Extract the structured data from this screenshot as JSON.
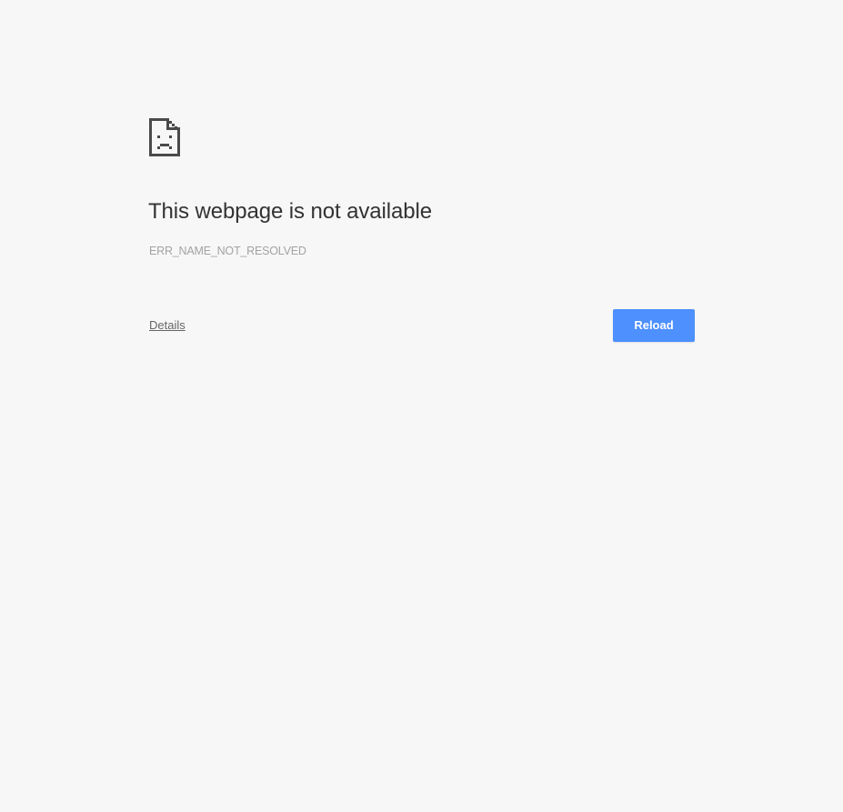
{
  "error": {
    "icon": "sad-page-icon",
    "title": "This webpage is not available",
    "code": "ERR_NAME_NOT_RESOLVED"
  },
  "actions": {
    "details_label": "Details",
    "reload_label": "Reload"
  },
  "colors": {
    "background": "#f7f7f7",
    "accent": "#4d90fe",
    "title_text": "#333333",
    "code_text": "#a3a3a3",
    "link_text": "#666666",
    "icon": "#4a4a4a"
  }
}
